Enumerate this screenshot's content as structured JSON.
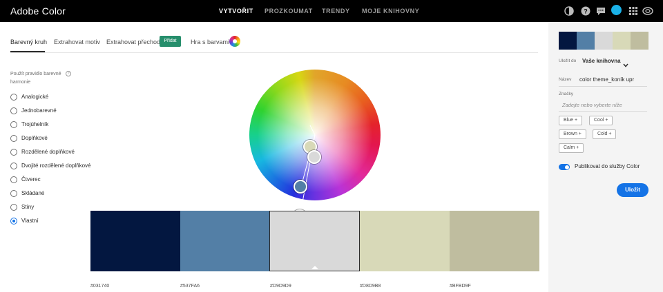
{
  "app": {
    "title": "Adobe Color"
  },
  "nav": {
    "items": [
      {
        "label": "VYTVOŘIT",
        "active": true
      },
      {
        "label": "PROZKOUMAT",
        "active": false
      },
      {
        "label": "TRENDY",
        "active": false
      },
      {
        "label": "MOJE KNIHOVNY",
        "active": false
      }
    ]
  },
  "header_icons": [
    "theme-toggle-icon",
    "help-icon",
    "chat-icon",
    "user-avatar-icon",
    "apps-grid-icon",
    "creative-cloud-icon"
  ],
  "tabs": [
    {
      "label": "Barevný kruh",
      "active": true
    },
    {
      "label": "Extrahovat motiv",
      "active": false
    },
    {
      "label": "Extrahovat přechod",
      "active": false,
      "badge": "Přidat"
    },
    {
      "label": "Hra s barvami",
      "active": false
    }
  ],
  "harmony": {
    "title": "Použít pravidlo barevné harmonie",
    "rules": [
      {
        "label": "Analogické",
        "selected": false
      },
      {
        "label": "Jednobarevné",
        "selected": false
      },
      {
        "label": "Trojúhelník",
        "selected": false
      },
      {
        "label": "Doplňkové",
        "selected": false
      },
      {
        "label": "Rozdělené doplňkové",
        "selected": false
      },
      {
        "label": "Dvojité rozdělené doplňkové",
        "selected": false
      },
      {
        "label": "Čtverec",
        "selected": false
      },
      {
        "label": "Skládané",
        "selected": false
      },
      {
        "label": "Stíny",
        "selected": false
      },
      {
        "label": "Vlastní",
        "selected": true
      }
    ]
  },
  "swatches": [
    {
      "hex": "#031740",
      "color": "#031740",
      "selected": false
    },
    {
      "hex": "#537FA6",
      "color": "#537FA6",
      "selected": false
    },
    {
      "hex": "#D9D9D9",
      "color": "#D9D9D9",
      "selected": true
    },
    {
      "hex": "#D8D9B8",
      "color": "#D8D9B8",
      "selected": false
    },
    {
      "hex": "#BFBD9F",
      "color": "#BFBD9F",
      "selected": false
    }
  ],
  "save_panel": {
    "save_to_label": "Uložit do",
    "library": "Vaše knihovna",
    "name_label": "Název",
    "name_value": "color theme_koník upr",
    "tags_label": "Značky",
    "tags_placeholder": "Zadejte nebo vyberte níže",
    "tags": [
      "Blue",
      "Cool",
      "Brown",
      "Cold",
      "Calm"
    ],
    "publish_label": "Publikovat do služby Color",
    "publish_on": true,
    "save_button": "Uložit"
  },
  "colors": {
    "accent": "#1473e6",
    "badge": "#268e6c",
    "topbar": "#000000"
  }
}
